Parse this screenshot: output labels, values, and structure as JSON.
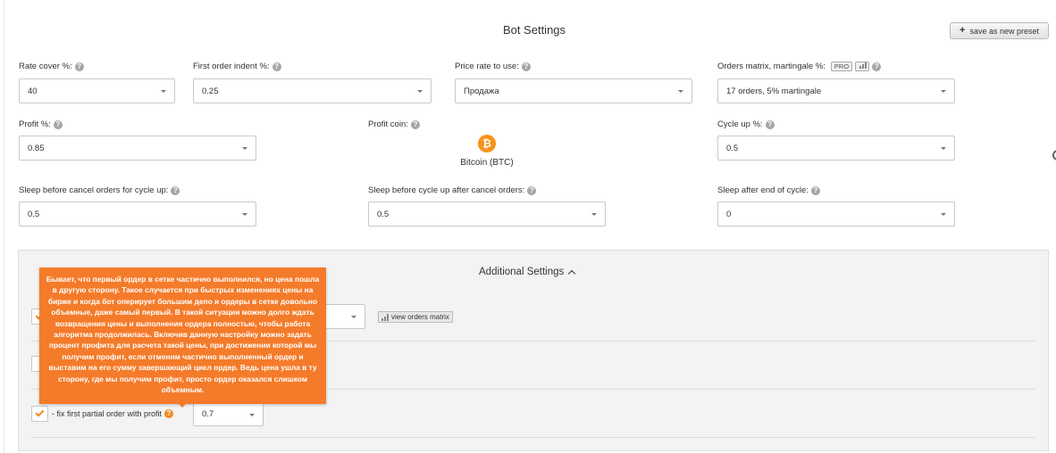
{
  "page": {
    "title": "Bot Settings",
    "save_preset_label": "save as new preset"
  },
  "fields": {
    "rate_cover": {
      "label": "Rate cover %:",
      "value": "40"
    },
    "first_order_indent": {
      "label": "First order indent %:",
      "value": "0.25"
    },
    "price_rate": {
      "label": "Price rate to use:",
      "value": "Продажа"
    },
    "orders_matrix": {
      "label": "Orders matrix, martingale %:",
      "badge": "PRO",
      "value": "17 orders, 5% martingale"
    },
    "profit": {
      "label": "Profit %:",
      "value": "0.85"
    },
    "profit_coin": {
      "label": "Profit coin:",
      "coin_symbol": "₿",
      "coin_name": "Bitcoin (BTC)"
    },
    "cycle_up": {
      "label": "Cycle up %:",
      "value": "0.5"
    },
    "sleep_cancel": {
      "label": "Sleep before cancel orders for cycle up:",
      "value": "0.5"
    },
    "sleep_cycle_up": {
      "label": "Sleep before cycle up after cancel orders:",
      "value": "0.5"
    },
    "sleep_end": {
      "label": "Sleep after end of cycle:",
      "value": "0"
    }
  },
  "additional": {
    "title": "Additional Settings",
    "view_matrix_label": "view orders matrix",
    "fix_partial": {
      "label": "- fix first partial order with profit",
      "checked": true,
      "value": "0.7"
    },
    "tooltip": "Бывает, что первый ордер в сетке частично выполнился, но цена пошла в другую сторону. Такое случается при быстрых изменениях цены на бирже и когда бот оперирует большим депо и ордеры в сетке довольно объемные, даже самый первый. В такой ситуации можно долго ждать возвращения цены и выполнения ордера полностью, чтобы работа алгоритма продолжилась. Включив данную настройку можно задать процент профита для расчета такой цены, при достижении которой мы получим профит, если отменим частично выполненный ордер и выставим на его сумму завершающий цикл ордер. Ведь цена ушла в ту сторону, где мы получим профит, просто ордер оказался слишком объемным."
  },
  "colors": {
    "accent": "#f47b2a",
    "bitcoin": "#f7931a",
    "help_icon": "#a6a6a6"
  },
  "icons": {
    "help": "question-circle-icon",
    "plus": "plus-icon",
    "chart": "bar-chart-icon",
    "check": "checkmark-icon",
    "chevron": "chevron-up-icon"
  }
}
